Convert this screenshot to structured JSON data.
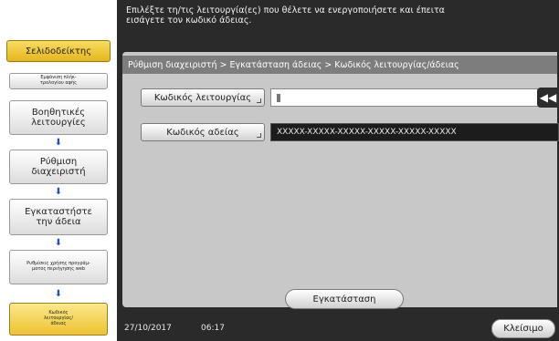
{
  "sidebar": {
    "bookmark_label": "Σελιδοδείκτης",
    "steps": [
      {
        "label": "Εμφάνιση πλήκ-\nτρολογίου αφής"
      },
      {
        "label": "Βοηθητικές\nλειτουργίες"
      },
      {
        "label": "Ρύθμιση\nδιαχειριστή"
      },
      {
        "label": "Εγκαταστήστε\nτην άδεια"
      },
      {
        "label": "Ρυθμίσεις χρήσης προγράμ-\nματος περιήγησης web"
      },
      {
        "label": "Κωδικός\nλειτουργίας/\nάδειας"
      }
    ],
    "arrow_glyph": "⬇"
  },
  "header": {
    "instruction": "Επιλέξτε τη/τις λειτουργία(ες) που θέλετε να ενεργοποιήσετε και έπειτα\nεισάγετε τον κωδικό άδειας."
  },
  "panel": {
    "breadcrumb": "Ρύθμιση διαχειριστή > Εγκατάσταση άδειας > Κωδικός λειτουργίας/άδειας",
    "function_code_label": "Κωδικός λειτουργίας",
    "function_code_value": "",
    "license_code_label": "Κωδικός αδείας",
    "license_code_value": "XXXXX-XXXXX-XXXXX-XXXXX-XXXXX-XXXXX",
    "install_label": "Εγκατάσταση",
    "collapse_glyph": "◀◀"
  },
  "status": {
    "date": "27/10/2017",
    "time": "06:17",
    "close_label": "Κλείσιμο"
  }
}
